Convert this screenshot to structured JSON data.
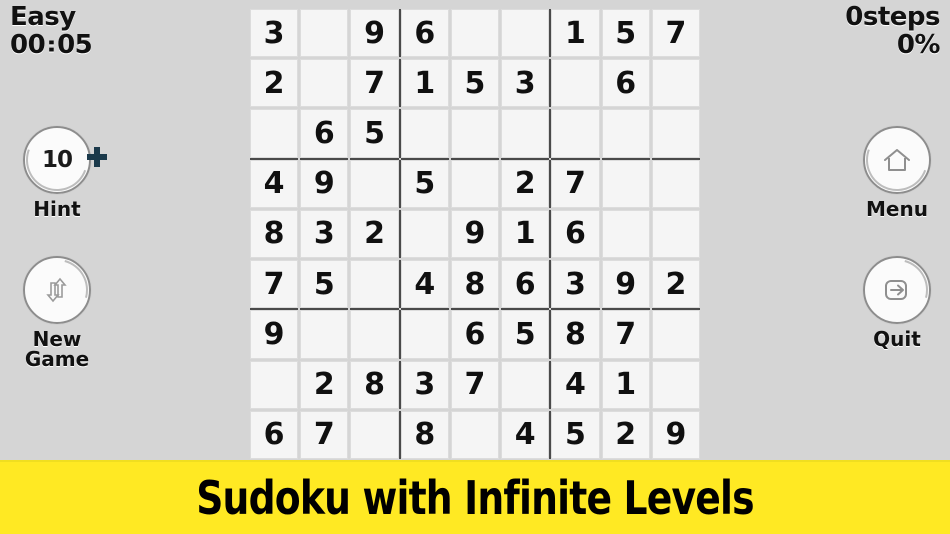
{
  "status": {
    "difficulty": "Easy",
    "timer": "00:05",
    "timer_minutes": "00",
    "timer_seconds": "05",
    "timer_separator": ":",
    "steps": "0steps",
    "progress": "0%"
  },
  "buttons": {
    "hint": {
      "label": "Hint",
      "count": "10",
      "icon": "hint-circle-icon",
      "badge_icon": "plus-icon"
    },
    "new_game": {
      "label": "New\nGame",
      "label_line1": "New",
      "label_line2": "Game",
      "icon": "refresh-arrows-icon"
    },
    "menu": {
      "label": "Menu",
      "icon": "home-icon"
    },
    "quit": {
      "label": "Quit",
      "icon": "exit-arrow-icon"
    }
  },
  "banner": {
    "text": "Sudoku with Infinite Levels",
    "background_color": "#ffe923",
    "text_color": "#000000"
  },
  "colors": {
    "page_background": "#d5d5d5",
    "cell_background": "#f5f5f5",
    "cell_border": "#dcdcdc",
    "box_border": "#4a4a4a",
    "digit_color": "#101010",
    "plus_badge": "#1b3a4b"
  },
  "board": {
    "size": 9,
    "rows": [
      [
        "3",
        "",
        "9",
        "6",
        "",
        "",
        "1",
        "5",
        "7"
      ],
      [
        "2",
        "",
        "7",
        "1",
        "5",
        "3",
        "",
        "6",
        ""
      ],
      [
        "",
        "6",
        "5",
        "",
        "",
        "",
        "",
        "",
        ""
      ],
      [
        "4",
        "9",
        "",
        "5",
        "",
        "2",
        "7",
        "",
        ""
      ],
      [
        "8",
        "3",
        "2",
        "",
        "9",
        "1",
        "6",
        "",
        ""
      ],
      [
        "7",
        "5",
        "",
        "4",
        "8",
        "6",
        "3",
        "9",
        "2"
      ],
      [
        "9",
        "",
        "",
        "",
        "6",
        "5",
        "8",
        "7",
        ""
      ],
      [
        "",
        "2",
        "8",
        "3",
        "7",
        "",
        "4",
        "1",
        ""
      ],
      [
        "6",
        "7",
        "",
        "8",
        "",
        "4",
        "5",
        "2",
        "9"
      ]
    ]
  }
}
